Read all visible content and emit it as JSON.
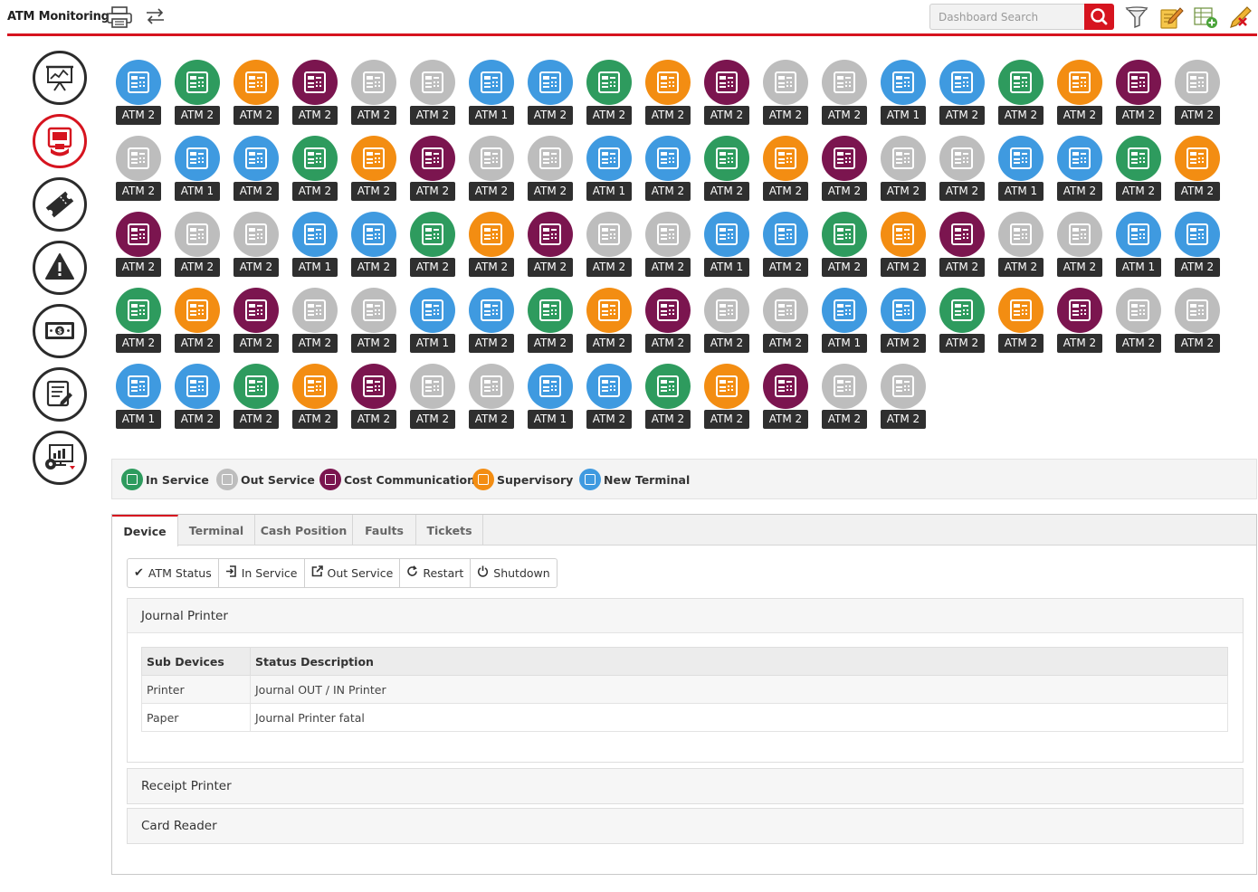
{
  "header": {
    "title": "ATM Monitoring",
    "search_placeholder": "Dashboard Search",
    "icons": [
      "printer-icon",
      "swap-icon",
      "search-icon",
      "filter-icon",
      "edit-note-icon",
      "add-sheet-icon",
      "clear-edit-icon"
    ]
  },
  "colors": {
    "accent": "#d6141f",
    "in_service": "#2e9b5e",
    "out_service": "#bdbdbd",
    "cost_communication": "#7b154f",
    "supervisory": "#f38d12",
    "new_terminal": "#3f9ae0"
  },
  "sidebar": {
    "items": [
      {
        "name": "dashboard",
        "icon": "presentation-chart-icon"
      },
      {
        "name": "atm",
        "icon": "atm-icon",
        "active": true
      },
      {
        "name": "tickets",
        "icon": "ticket-icon"
      },
      {
        "name": "alerts",
        "icon": "warning-icon"
      },
      {
        "name": "cash",
        "icon": "cash-icon"
      },
      {
        "name": "reports",
        "icon": "report-edit-icon"
      },
      {
        "name": "settings",
        "icon": "display-settings-icon"
      }
    ]
  },
  "atm_grid": {
    "rows": [
      [
        {
          "label": "ATM 2",
          "status": "new_terminal"
        },
        {
          "label": "ATM 2",
          "status": "in_service"
        },
        {
          "label": "ATM 2",
          "status": "supervisory"
        },
        {
          "label": "ATM 2",
          "status": "cost_communication"
        },
        {
          "label": "ATM 2",
          "status": "out_service"
        },
        {
          "label": "ATM 2",
          "status": "out_service"
        },
        {
          "label": "ATM 1",
          "status": "new_terminal"
        },
        {
          "label": "ATM 2",
          "status": "new_terminal"
        },
        {
          "label": "ATM 2",
          "status": "in_service"
        },
        {
          "label": "ATM 2",
          "status": "supervisory"
        },
        {
          "label": "ATM 2",
          "status": "cost_communication"
        },
        {
          "label": "ATM 2",
          "status": "out_service"
        },
        {
          "label": "ATM 2",
          "status": "out_service"
        },
        {
          "label": "ATM 1",
          "status": "new_terminal"
        },
        {
          "label": "ATM 2",
          "status": "new_terminal"
        },
        {
          "label": "ATM 2",
          "status": "in_service"
        },
        {
          "label": "ATM 2",
          "status": "supervisory"
        },
        {
          "label": "ATM 2",
          "status": "cost_communication"
        },
        {
          "label": "ATM 2",
          "status": "out_service"
        }
      ],
      [
        {
          "label": "ATM 2",
          "status": "out_service"
        },
        {
          "label": "ATM 1",
          "status": "new_terminal"
        },
        {
          "label": "ATM 2",
          "status": "new_terminal"
        },
        {
          "label": "ATM 2",
          "status": "in_service"
        },
        {
          "label": "ATM 2",
          "status": "supervisory"
        },
        {
          "label": "ATM 2",
          "status": "cost_communication"
        },
        {
          "label": "ATM 2",
          "status": "out_service"
        },
        {
          "label": "ATM 2",
          "status": "out_service"
        },
        {
          "label": "ATM 1",
          "status": "new_terminal"
        },
        {
          "label": "ATM 2",
          "status": "new_terminal"
        },
        {
          "label": "ATM 2",
          "status": "in_service"
        },
        {
          "label": "ATM 2",
          "status": "supervisory"
        },
        {
          "label": "ATM 2",
          "status": "cost_communication"
        },
        {
          "label": "ATM 2",
          "status": "out_service"
        },
        {
          "label": "ATM 2",
          "status": "out_service"
        },
        {
          "label": "ATM 1",
          "status": "new_terminal"
        },
        {
          "label": "ATM 2",
          "status": "new_terminal"
        },
        {
          "label": "ATM 2",
          "status": "in_service"
        },
        {
          "label": "ATM 2",
          "status": "supervisory"
        }
      ],
      [
        {
          "label": "ATM 2",
          "status": "cost_communication"
        },
        {
          "label": "ATM 2",
          "status": "out_service"
        },
        {
          "label": "ATM 2",
          "status": "out_service"
        },
        {
          "label": "ATM 1",
          "status": "new_terminal"
        },
        {
          "label": "ATM 2",
          "status": "new_terminal"
        },
        {
          "label": "ATM 2",
          "status": "in_service"
        },
        {
          "label": "ATM 2",
          "status": "supervisory"
        },
        {
          "label": "ATM 2",
          "status": "cost_communication"
        },
        {
          "label": "ATM 2",
          "status": "out_service"
        },
        {
          "label": "ATM 2",
          "status": "out_service"
        },
        {
          "label": "ATM 1",
          "status": "new_terminal"
        },
        {
          "label": "ATM 2",
          "status": "new_terminal"
        },
        {
          "label": "ATM 2",
          "status": "in_service"
        },
        {
          "label": "ATM 2",
          "status": "supervisory"
        },
        {
          "label": "ATM 2",
          "status": "cost_communication"
        },
        {
          "label": "ATM 2",
          "status": "out_service"
        },
        {
          "label": "ATM 2",
          "status": "out_service"
        },
        {
          "label": "ATM 1",
          "status": "new_terminal"
        },
        {
          "label": "ATM 2",
          "status": "new_terminal"
        }
      ],
      [
        {
          "label": "ATM 2",
          "status": "in_service"
        },
        {
          "label": "ATM 2",
          "status": "supervisory"
        },
        {
          "label": "ATM 2",
          "status": "cost_communication"
        },
        {
          "label": "ATM 2",
          "status": "out_service"
        },
        {
          "label": "ATM 2",
          "status": "out_service"
        },
        {
          "label": "ATM 1",
          "status": "new_terminal"
        },
        {
          "label": "ATM 2",
          "status": "new_terminal"
        },
        {
          "label": "ATM 2",
          "status": "in_service"
        },
        {
          "label": "ATM 2",
          "status": "supervisory"
        },
        {
          "label": "ATM 2",
          "status": "cost_communication"
        },
        {
          "label": "ATM 2",
          "status": "out_service"
        },
        {
          "label": "ATM 2",
          "status": "out_service"
        },
        {
          "label": "ATM 1",
          "status": "new_terminal"
        },
        {
          "label": "ATM 2",
          "status": "new_terminal"
        },
        {
          "label": "ATM 2",
          "status": "in_service"
        },
        {
          "label": "ATM 2",
          "status": "supervisory"
        },
        {
          "label": "ATM 2",
          "status": "cost_communication"
        },
        {
          "label": "ATM 2",
          "status": "out_service"
        },
        {
          "label": "ATM 2",
          "status": "out_service"
        }
      ],
      [
        {
          "label": "ATM 1",
          "status": "new_terminal"
        },
        {
          "label": "ATM 2",
          "status": "new_terminal"
        },
        {
          "label": "ATM 2",
          "status": "in_service"
        },
        {
          "label": "ATM 2",
          "status": "supervisory"
        },
        {
          "label": "ATM 2",
          "status": "cost_communication"
        },
        {
          "label": "ATM 2",
          "status": "out_service"
        },
        {
          "label": "ATM 2",
          "status": "out_service"
        },
        {
          "label": "ATM 1",
          "status": "new_terminal"
        },
        {
          "label": "ATM 2",
          "status": "new_terminal"
        },
        {
          "label": "ATM 2",
          "status": "in_service"
        },
        {
          "label": "ATM 2",
          "status": "supervisory"
        },
        {
          "label": "ATM 2",
          "status": "cost_communication"
        },
        {
          "label": "ATM 2",
          "status": "out_service"
        },
        {
          "label": "ATM 2",
          "status": "out_service"
        }
      ]
    ]
  },
  "legend": [
    {
      "label": "In Service",
      "status": "in_service"
    },
    {
      "label": "Out Service",
      "status": "out_service"
    },
    {
      "label": "Cost Communication",
      "status": "cost_communication"
    },
    {
      "label": "Supervisory",
      "status": "supervisory"
    },
    {
      "label": "New Terminal",
      "status": "new_terminal"
    }
  ],
  "tabs": [
    {
      "label": "Device",
      "active": true
    },
    {
      "label": "Terminal"
    },
    {
      "label": "Cash Position"
    },
    {
      "label": "Faults"
    },
    {
      "label": "Tickets"
    }
  ],
  "toolbar": {
    "atm_status": "ATM Status",
    "in_service": "In Service",
    "out_service": "Out Service",
    "restart": "Restart",
    "shutdown": "Shutdown"
  },
  "journal_printer": {
    "title": "Journal Printer",
    "columns": [
      "Sub Devices",
      "Status Description"
    ],
    "rows": [
      [
        "Printer",
        "Journal OUT / IN Printer"
      ],
      [
        "Paper",
        "Journal Printer fatal"
      ]
    ]
  },
  "receipt_printer": {
    "title": "Receipt Printer"
  },
  "card_reader": {
    "title": "Card Reader"
  }
}
